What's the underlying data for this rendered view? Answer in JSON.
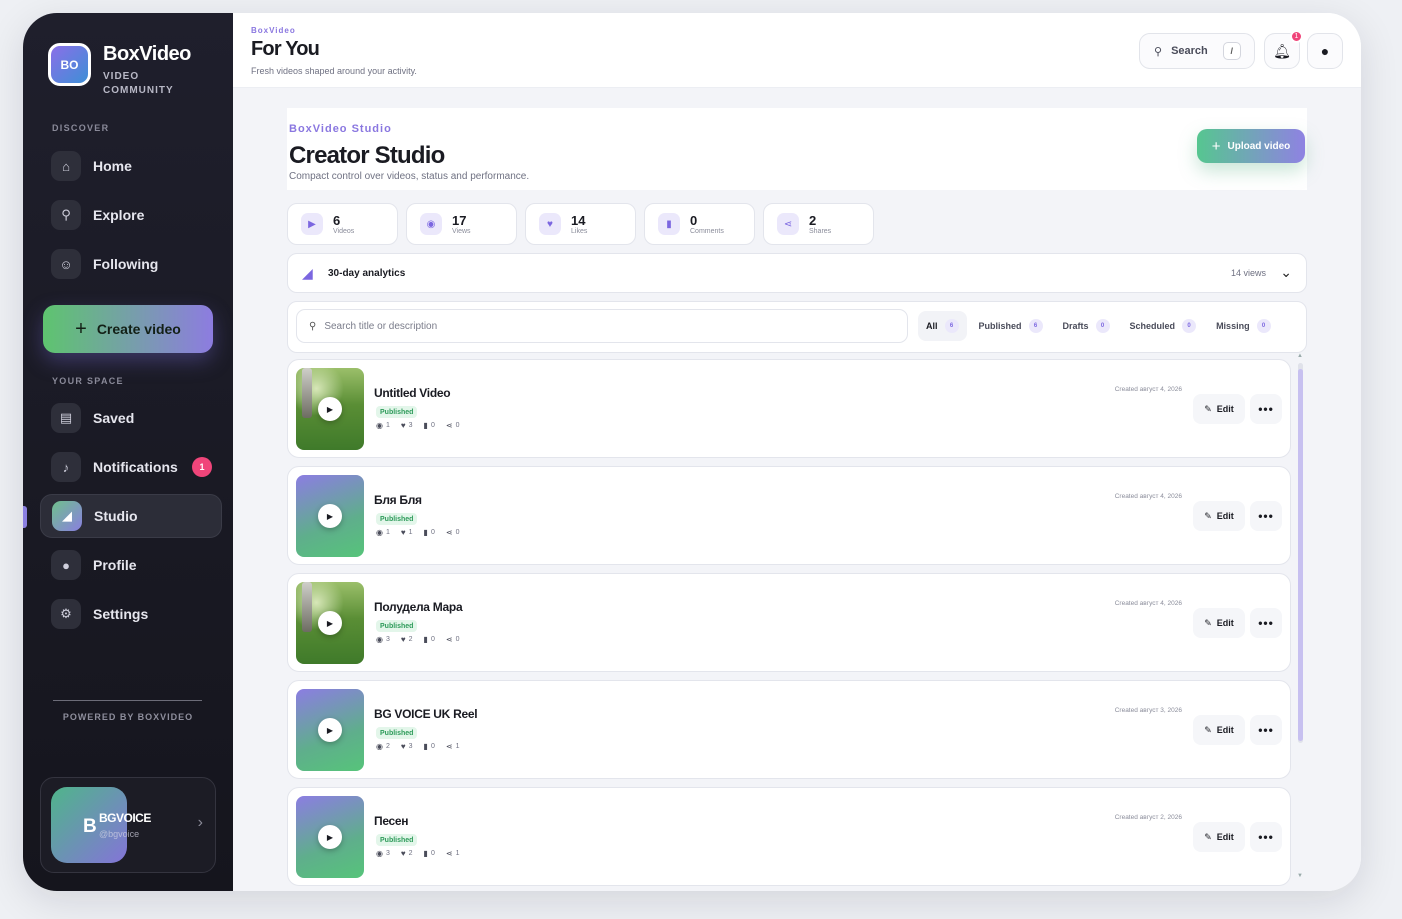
{
  "brand": {
    "logo": "BO",
    "title": "BoxVideo",
    "sub_line1": "VIDEO",
    "sub_line2": "COMMUNITY"
  },
  "sidebar": {
    "discover_label": "DISCOVER",
    "discover": [
      {
        "label": "Home",
        "icon": "home-icon"
      },
      {
        "label": "Explore",
        "icon": "search-icon"
      },
      {
        "label": "Following",
        "icon": "users-icon"
      }
    ],
    "create_label": "Create video",
    "space_label": "YOUR SPACE",
    "space": [
      {
        "label": "Saved",
        "icon": "bookmark-icon"
      },
      {
        "label": "Notifications",
        "icon": "bell-icon",
        "badge": "1"
      },
      {
        "label": "Studio",
        "icon": "chart-icon",
        "active": true
      },
      {
        "label": "Profile",
        "icon": "user-icon"
      },
      {
        "label": "Settings",
        "icon": "gear-icon"
      }
    ],
    "powered": "POWERED BY BOXVIDEO",
    "user": {
      "initial": "B",
      "name": "BGVOICE",
      "handle": "@bgvoice"
    }
  },
  "header": {
    "crumb": "BoxVideo",
    "title": "For You",
    "subtitle": "Fresh videos shaped around your activity.",
    "search_label": "Search",
    "search_key": "/",
    "bell_badge": "1"
  },
  "studio": {
    "crumb": "BoxVideo Studio",
    "title": "Creator Studio",
    "subtitle": "Compact control over videos, status and performance.",
    "upload_label": "Upload video",
    "stats": [
      {
        "value": "6",
        "label": "Videos",
        "icon": "video-icon"
      },
      {
        "value": "17",
        "label": "Views",
        "icon": "eye-icon"
      },
      {
        "value": "14",
        "label": "Likes",
        "icon": "heart-icon"
      },
      {
        "value": "0",
        "label": "Comments",
        "icon": "comment-icon"
      },
      {
        "value": "2",
        "label": "Shares",
        "icon": "share-icon"
      }
    ],
    "analytics": {
      "title": "30-day analytics",
      "meta": "14 views"
    },
    "search_placeholder": "Search title or description",
    "tabs": [
      {
        "label": "All",
        "count": "6",
        "active": true
      },
      {
        "label": "Published",
        "count": "6"
      },
      {
        "label": "Drafts",
        "count": "0"
      },
      {
        "label": "Scheduled",
        "count": "0"
      },
      {
        "label": "Missing",
        "count": "0"
      }
    ],
    "edit_label": "Edit",
    "videos": [
      {
        "title": "Untitled Video",
        "status": "Published",
        "views": "1",
        "likes": "3",
        "comments": "0",
        "shares": "0",
        "date": "Created август 4, 2026",
        "thumb": "photo"
      },
      {
        "title": "Бля Бля",
        "status": "Published",
        "views": "1",
        "likes": "1",
        "comments": "0",
        "shares": "0",
        "date": "Created август 4, 2026",
        "thumb": "grad"
      },
      {
        "title": "Полудела Мара",
        "status": "Published",
        "views": "3",
        "likes": "2",
        "comments": "0",
        "shares": "0",
        "date": "Created август 4, 2026",
        "thumb": "photo"
      },
      {
        "title": "BG VOICE UK Reel",
        "status": "Published",
        "views": "2",
        "likes": "3",
        "comments": "0",
        "shares": "1",
        "date": "Created август 3, 2026",
        "thumb": "grad"
      },
      {
        "title": "Песен",
        "status": "Published",
        "views": "3",
        "likes": "2",
        "comments": "0",
        "shares": "1",
        "date": "Created август 2, 2026",
        "thumb": "grad"
      }
    ]
  }
}
